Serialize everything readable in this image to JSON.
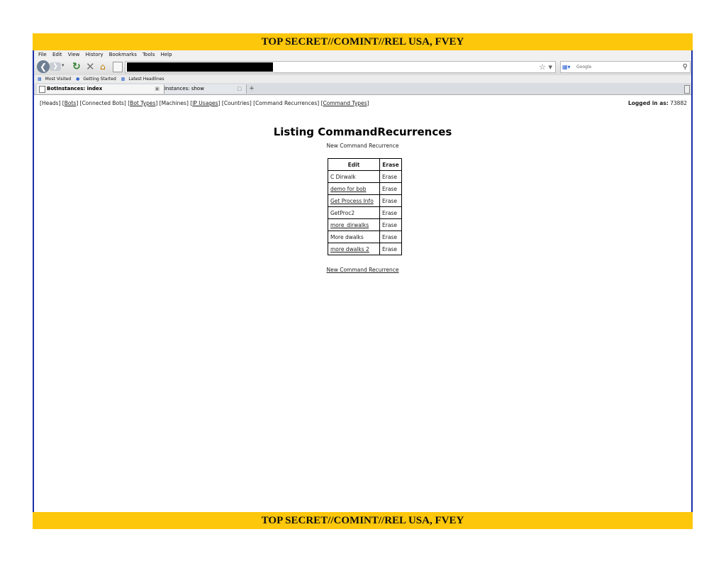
{
  "classification": {
    "banner_text": "TOP SECRET//COMINT//REL USA, FVEY"
  },
  "colors": {
    "banner": "#fdc70b",
    "frame_border": "#1a2fa6"
  },
  "browser": {
    "menu": [
      "File",
      "Edit",
      "View",
      "History",
      "Bookmarks",
      "Tools",
      "Help"
    ],
    "search_placeholder": "Google",
    "bookmarks": [
      "Most Visited",
      "Getting Started",
      "Latest Headlines"
    ],
    "tabs": [
      {
        "label": "BotInstances: index",
        "active": true
      },
      {
        "label": "BotInstances: show",
        "active": false
      }
    ],
    "new_tab_label": "+"
  },
  "page": {
    "nav_links": [
      "Heads",
      "Bots",
      "Connected Bots",
      "Bot Types",
      "Machines",
      "IP Usages",
      "Countries",
      "Command Recurrences",
      "Command Types"
    ],
    "logged_in_label": "Logged in as:",
    "logged_in_user": "73882",
    "title": "Listing CommandRecurrences",
    "new_link": "New Command Recurrence",
    "table": {
      "headers": [
        "Edit",
        "Erase"
      ],
      "rows": [
        {
          "name": "C Dirwalk",
          "action": "Erase"
        },
        {
          "name": "demo for bob",
          "action": "Erase"
        },
        {
          "name": "Get Process Info",
          "action": "Erase"
        },
        {
          "name": "GetProc2",
          "action": "Erase"
        },
        {
          "name": "more_dirwalks",
          "action": "Erase"
        },
        {
          "name": "More dwalks",
          "action": "Erase"
        },
        {
          "name": "more dwalks 2",
          "action": "Erase"
        }
      ]
    }
  }
}
